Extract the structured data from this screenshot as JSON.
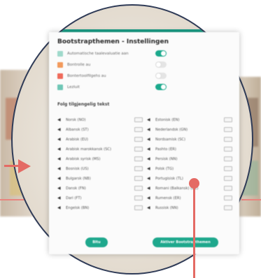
{
  "dialog": {
    "title": "Bootstrapthemen - Instellingen",
    "settings": [
      {
        "label": "Automatische taalevaluatie aan",
        "icon_color": "#9fd9cb",
        "on": true
      },
      {
        "label": "Bontrolle au",
        "icon_color": "#f29a5c",
        "on": false
      },
      {
        "label": "Bontertoolfilgehs au",
        "icon_color": "#ef6a5a",
        "on": false
      },
      {
        "label": "Lezluit",
        "icon_color": "#6fc7b6",
        "on": true
      }
    ],
    "section_title": "Folg tilgjengelig tekst",
    "languages_left": [
      "Norsk (NO)",
      "Albansk (ST)",
      "Arabisk (EU)",
      "Arabisk marokkansk (SC)",
      "Arabisk syrisk (MS)",
      "Bosnisk (US)",
      "Bulgarsk (NB)",
      "Dansk (FN)",
      "Dari (FT)",
      "Engelsk (BN)"
    ],
    "languages_right": [
      "Estonisk (EN)",
      "Nederlandsk (GN)",
      "Nordsamisk (SC)",
      "Pashto (ER)",
      "Persisk (NN)",
      "Polsk (TG)",
      "Portugisisk (TL)",
      "Romani (Balkansk) (DE)",
      "Rumensk (ER)",
      "Russisk (NN)"
    ],
    "buttons": {
      "left": "Bltu",
      "right": "Aktiver Bootstrapthemen"
    }
  },
  "colors": {
    "accent": "#1ba98c",
    "arrow": "#e46a64",
    "circle_border": "#2f3b57"
  }
}
